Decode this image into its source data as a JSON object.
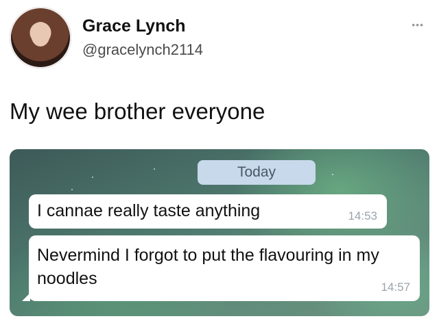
{
  "tweet": {
    "author_name": "Grace Lynch",
    "author_handle": "@gracelynch2114",
    "more_label": "•••",
    "text": "My wee brother everyone"
  },
  "chat": {
    "date_label": "Today",
    "messages": [
      {
        "text": "I cannae really taste anything",
        "time": "14:53"
      },
      {
        "text": "Nevermind I forgot to put the flavouring in my noodles",
        "time": "14:57"
      }
    ]
  },
  "colors": {
    "date_chip": "#c7d9ea",
    "bubble": "#ffffff",
    "time_text": "#9aa3ab"
  },
  "icons": {
    "more": "more-options-icon",
    "avatar": "profile-avatar"
  }
}
